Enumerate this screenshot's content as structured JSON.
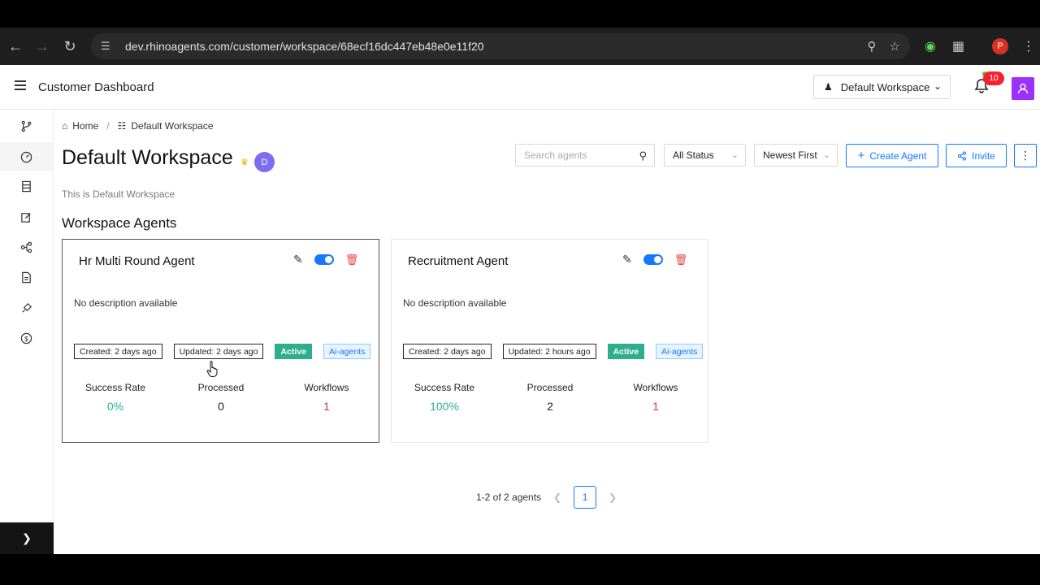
{
  "browser": {
    "url": "dev.rhinoagents.com/customer/workspace/68ecf16dc447eb48e0e11f20",
    "profile_initial": "P"
  },
  "header": {
    "app_title": "Customer Dashboard",
    "workspace_select": "Default Workspace",
    "notification_count": "10"
  },
  "breadcrumb": {
    "home": "Home",
    "current": "Default Workspace"
  },
  "page": {
    "title": "Default Workspace",
    "owner_initial": "D",
    "description": "This is Default Workspace",
    "section_title": "Workspace Agents"
  },
  "toolbar": {
    "search_placeholder": "Search agents",
    "status_filter": "All Status",
    "sort": "Newest First",
    "create_label": "Create Agent",
    "invite_label": "Invite"
  },
  "agents": [
    {
      "name": "Hr Multi Round Agent",
      "description": "No description available",
      "created": "Created: 2 days ago",
      "updated": "Updated: 2 days ago",
      "status": "Active",
      "category": "Ai-agents",
      "enabled": true,
      "success_rate_label": "Success Rate",
      "success_rate": "0%",
      "processed_label": "Processed",
      "processed": "0",
      "workflows_label": "Workflows",
      "workflows": "1"
    },
    {
      "name": "Recruitment Agent",
      "description": "No description available",
      "created": "Created: 2 days ago",
      "updated": "Updated: 2 hours ago",
      "status": "Active",
      "category": "Ai-agents",
      "enabled": true,
      "success_rate_label": "Success Rate",
      "success_rate": "100%",
      "processed_label": "Processed",
      "processed": "2",
      "workflows_label": "Workflows",
      "workflows": "1"
    }
  ],
  "pagination": {
    "summary": "1-2 of 2 agents",
    "current_page": "1"
  },
  "colors": {
    "primary": "#1677ff",
    "active_tag": "#2fae8f",
    "success": "#2fae8f",
    "workflows": "#d9363e",
    "avatar_user": "#9b30ff",
    "avatar_owner": "#7b6cf0"
  }
}
